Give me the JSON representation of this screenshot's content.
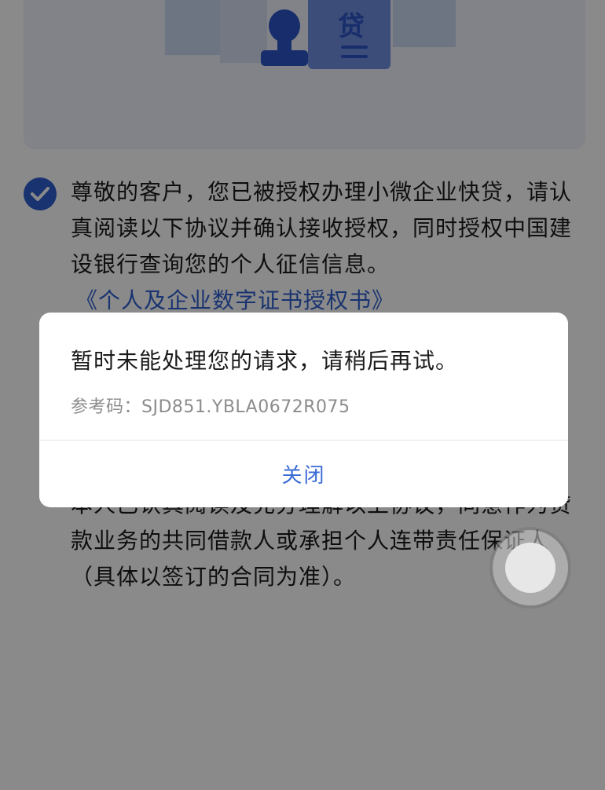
{
  "banner": {
    "badge_text": "贷"
  },
  "agreement": {
    "lines": [
      "尊敬的客户，您已被授权办理小微企业快贷，请认",
      "真阅读以下协议并确认接收授权，同时授权中国建",
      "设银行查询您的个人征信信息。"
    ],
    "link": "《个人及企业数字证书授权书》",
    "bottom_lines": [
      "本人已认真阅读及充分理解以上协议，同意作为贷",
      "款业务的共同借款人或承担个人连带责任保证人",
      "（具体以签订的合同为准）。"
    ]
  },
  "dialog": {
    "message": "暂时未能处理您的请求，请稍后再试。",
    "reference": "参考码：SJD851.YBLA0672R075",
    "close_label": "关闭"
  },
  "colors": {
    "accent": "#2f5fd0",
    "dialog_button": "#3a6ad6"
  }
}
